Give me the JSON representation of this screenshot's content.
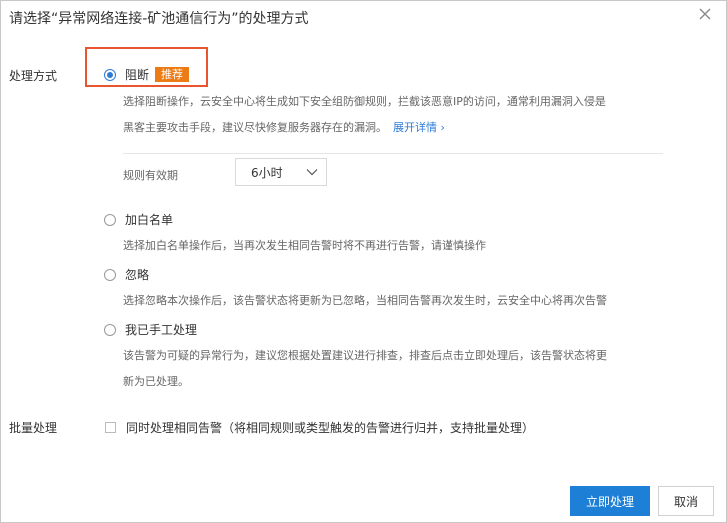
{
  "dialog": {
    "title": "请选择“异常网络连接-矿池通信行为”的处理方式"
  },
  "handling": {
    "section_label": "处理方式",
    "options": [
      {
        "label": "阻断",
        "badge": "推荐",
        "checked": true,
        "desc_line1": "选择阻断操作，云安全中心将生成如下安全组防御规则，拦截该恶意IP的访问，通常利用漏洞入侵是",
        "desc_line2": "黑客主要攻击手段，建议尽快修复服务器存在的漏洞。",
        "link": "展开详情 ›",
        "rule_label": "规则有效期",
        "duration": "6小时"
      },
      {
        "label": "加白名单",
        "checked": false,
        "desc": "选择加白名单操作后，当再次发生相同告警时将不再进行告警，请谨慎操作"
      },
      {
        "label": "忽略",
        "checked": false,
        "desc": "选择忽略本次操作后，该告警状态将更新为已忽略，当相同告警再次发生时，云安全中心将再次告警"
      },
      {
        "label": "我已手工处理",
        "checked": false,
        "desc_line1": "该告警为可疑的异常行为，建议您根据处置建议进行排查，排查后点击立即处理后，该告警状态将更",
        "desc_line2": "新为已处理。"
      }
    ]
  },
  "batch": {
    "section_label": "批量处理",
    "checkbox_label": "同时处理相同告警（将相同规则或类型触发的告警进行归并，支持批量处理）",
    "checked": false
  },
  "footer": {
    "confirm": "立即处理",
    "cancel": "取消"
  },
  "colors": {
    "accent": "#1e7fd6",
    "badge": "#ec7b16",
    "highlight": "#e8552f"
  }
}
